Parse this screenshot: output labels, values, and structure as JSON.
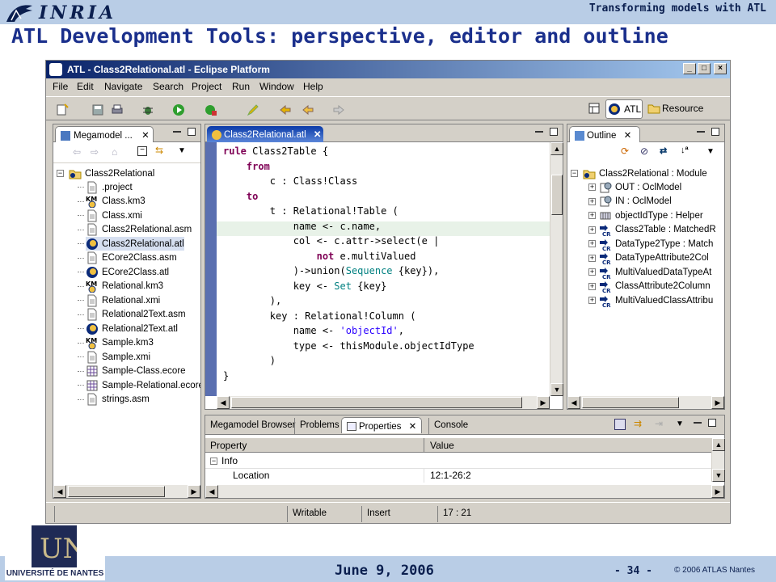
{
  "slide": {
    "header_title": "Transforming models with ATL",
    "title": "ATL Development Tools: perspective, editor and outline",
    "date": "June 9, 2006",
    "page": "- 34 -",
    "copyright": "© 2006 ATLAS Nantes",
    "university": "UNIVERSITÉ DE NANTES",
    "inria_logo_text": "INRIA",
    "univ_logo_text": "UN"
  },
  "window": {
    "title": "ATL - Class2Relational.atl - Eclipse Platform",
    "menu": [
      "File",
      "Edit",
      "Navigate",
      "Search",
      "Project",
      "Run",
      "Window",
      "Help"
    ],
    "perspectives": [
      "ATL",
      "Resource"
    ]
  },
  "megamodel": {
    "tab_label": "Megamodel ...",
    "root": "Class2Relational",
    "files": [
      {
        "name": ".project",
        "icon": "file-icon"
      },
      {
        "name": "Class.km3",
        "icon": "km3-icon"
      },
      {
        "name": "Class.xmi",
        "icon": "file-icon"
      },
      {
        "name": "Class2Relational.asm",
        "icon": "file-icon"
      },
      {
        "name": "Class2Relational.atl",
        "icon": "atl-icon"
      },
      {
        "name": "ECore2Class.asm",
        "icon": "file-icon"
      },
      {
        "name": "ECore2Class.atl",
        "icon": "atl-icon"
      },
      {
        "name": "Relational.km3",
        "icon": "km3-icon"
      },
      {
        "name": "Relational.xmi",
        "icon": "file-icon"
      },
      {
        "name": "Relational2Text.asm",
        "icon": "file-icon"
      },
      {
        "name": "Relational2Text.atl",
        "icon": "atl-icon"
      },
      {
        "name": "Sample.km3",
        "icon": "km3-icon"
      },
      {
        "name": "Sample.xmi",
        "icon": "file-icon"
      },
      {
        "name": "Sample-Class.ecore",
        "icon": "ecore-icon"
      },
      {
        "name": "Sample-Relational.ecore",
        "icon": "ecore-icon"
      },
      {
        "name": "strings.asm",
        "icon": "file-icon"
      }
    ]
  },
  "editor": {
    "tab_label": "Class2Relational.atl",
    "lines": [
      [
        {
          "t": "rule ",
          "c": "kw"
        },
        {
          "t": "Class2Table {",
          "c": ""
        }
      ],
      [
        {
          "t": "    ",
          "c": ""
        },
        {
          "t": "from",
          "c": "kw"
        }
      ],
      [
        {
          "t": "        c : Class!Class",
          "c": ""
        }
      ],
      [
        {
          "t": "    ",
          "c": ""
        },
        {
          "t": "to",
          "c": "kw"
        }
      ],
      [
        {
          "t": "        t : Relational!Table (",
          "c": ""
        }
      ],
      [
        {
          "t": "            name <- c.name,",
          "c": ""
        }
      ],
      [
        {
          "t": "            col <- c.attr->select(e |",
          "c": ""
        }
      ],
      [
        {
          "t": "                ",
          "c": ""
        },
        {
          "t": "not",
          "c": "kw"
        },
        {
          "t": " e.multiValued",
          "c": ""
        }
      ],
      [
        {
          "t": "            )->union(",
          "c": ""
        },
        {
          "t": "Sequence",
          "c": "tl"
        },
        {
          "t": " {key}),",
          "c": ""
        }
      ],
      [
        {
          "t": "            key <- ",
          "c": ""
        },
        {
          "t": "Set",
          "c": "tl"
        },
        {
          "t": " {key}",
          "c": ""
        }
      ],
      [
        {
          "t": "        ),",
          "c": ""
        }
      ],
      [
        {
          "t": "        key : Relational!Column (",
          "c": ""
        }
      ],
      [
        {
          "t": "            name <- ",
          "c": ""
        },
        {
          "t": "'objectId'",
          "c": "str"
        },
        {
          "t": ",",
          "c": ""
        }
      ],
      [
        {
          "t": "            type <- thisModule.objectIdType",
          "c": ""
        }
      ],
      [
        {
          "t": "        )",
          "c": ""
        }
      ],
      [
        {
          "t": "}",
          "c": ""
        }
      ]
    ]
  },
  "outline": {
    "tab_label": "Outline",
    "root": "Class2Relational : Module",
    "items": [
      {
        "name": "OUT : OclModel",
        "icon": "model-icon"
      },
      {
        "name": "IN : OclModel",
        "icon": "model-icon"
      },
      {
        "name": "objectIdType : Helper",
        "icon": "helper-icon"
      },
      {
        "name": "Class2Table : MatchedR",
        "icon": "rule-icon"
      },
      {
        "name": "DataType2Type : Match",
        "icon": "rule-icon"
      },
      {
        "name": "DataTypeAttribute2Col",
        "icon": "rule-icon"
      },
      {
        "name": "MultiValuedDataTypeAt",
        "icon": "rule-icon"
      },
      {
        "name": "ClassAttribute2Column",
        "icon": "rule-icon"
      },
      {
        "name": "MultiValuedClassAttribu",
        "icon": "rule-icon"
      }
    ]
  },
  "bottom": {
    "tabs": [
      "Megamodel Browser",
      "Problems",
      "Properties",
      "Console"
    ],
    "columns": [
      "Property",
      "Value"
    ],
    "rows": [
      {
        "property": "Info",
        "value": ""
      },
      {
        "property": "Location",
        "value": "12:1-26:2"
      }
    ]
  },
  "status": {
    "mode": "Writable",
    "insert": "Insert",
    "position": "17 : 21"
  }
}
